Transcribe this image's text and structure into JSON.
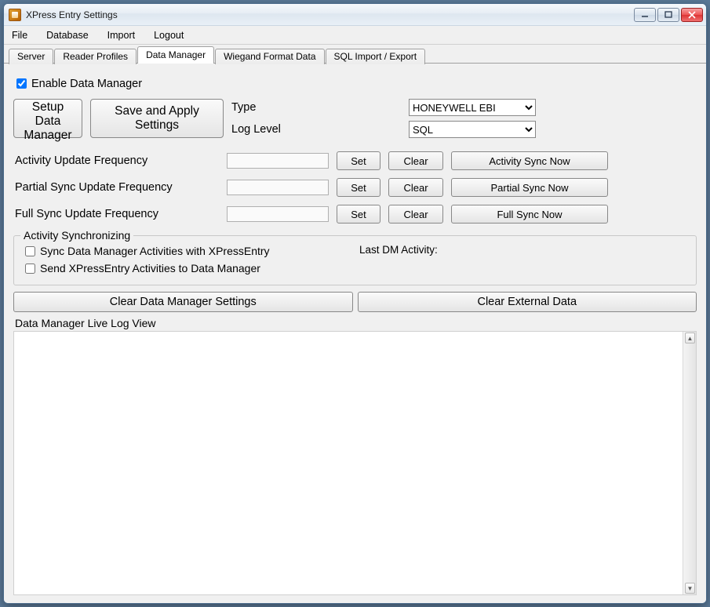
{
  "window": {
    "title": "XPress Entry Settings"
  },
  "menu": {
    "file": "File",
    "database": "Database",
    "import": "Import",
    "logout": "Logout"
  },
  "tabs": {
    "server": "Server",
    "reader_profiles": "Reader Profiles",
    "data_manager": "Data Manager",
    "wiegand": "Wiegand Format Data",
    "sql": "SQL Import / Export"
  },
  "enable": {
    "label": "Enable Data Manager",
    "checked": true
  },
  "typeRow": {
    "type_label": "Type",
    "type_value": "HONEYWELL EBI",
    "log_label": "Log Level",
    "log_value": "SQL",
    "setup_btn": "Setup Data Manager",
    "save_btn": "Save and Apply Settings"
  },
  "freq": {
    "activity": {
      "label": "Activity Update Frequency",
      "value": "",
      "set": "Set",
      "clear": "Clear",
      "sync": "Activity Sync Now"
    },
    "partial": {
      "label": "Partial Sync Update Frequency",
      "value": "",
      "set": "Set",
      "clear": "Clear",
      "sync": "Partial Sync Now"
    },
    "full": {
      "label": "Full Sync Update Frequency",
      "value": "",
      "set": "Set",
      "clear": "Clear",
      "sync": "Full Sync Now"
    }
  },
  "syncGroup": {
    "legend": "Activity Synchronizing",
    "chk1": "Sync Data Manager Activities with XPressEntry",
    "chk2": "Send XPressEntry Activities to Data Manager",
    "lastdm": "Last DM Activity:"
  },
  "clearBtns": {
    "settings": "Clear Data Manager Settings",
    "external": "Clear External Data"
  },
  "log": {
    "label": "Data Manager Live Log View"
  }
}
